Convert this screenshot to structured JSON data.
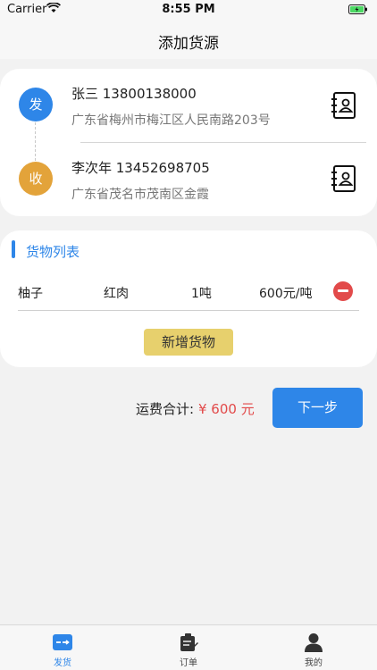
{
  "status_bar": {
    "carrier": "Carrier",
    "time": "8:55 PM"
  },
  "nav": {
    "title": "添加货源"
  },
  "sender": {
    "badge": "发",
    "name_phone": "张三 13800138000",
    "address": "广东省梅州市梅江区人民南路203号"
  },
  "receiver": {
    "badge": "收",
    "name_phone": "李次年 13452698705",
    "address": "广东省茂名市茂南区金霞"
  },
  "goods": {
    "section_title": "货物列表",
    "items": [
      {
        "name": "柚子",
        "type": "红肉",
        "weight": "1吨",
        "price": "600元/吨"
      }
    ],
    "add_label": "新增货物"
  },
  "summary": {
    "total_label": "运费合计:",
    "total_value": "¥ 600 元",
    "next_label": "下一步"
  },
  "tabs": [
    {
      "label": "发货",
      "icon": "send-cargo-icon",
      "active": true
    },
    {
      "label": "订单",
      "icon": "order-icon",
      "active": false
    },
    {
      "label": "我的",
      "icon": "user-icon",
      "active": false
    }
  ],
  "colors": {
    "accent": "#2e86e8",
    "receive": "#e3a33a",
    "danger": "#e24a4a",
    "add_button": "#e7d06d"
  }
}
